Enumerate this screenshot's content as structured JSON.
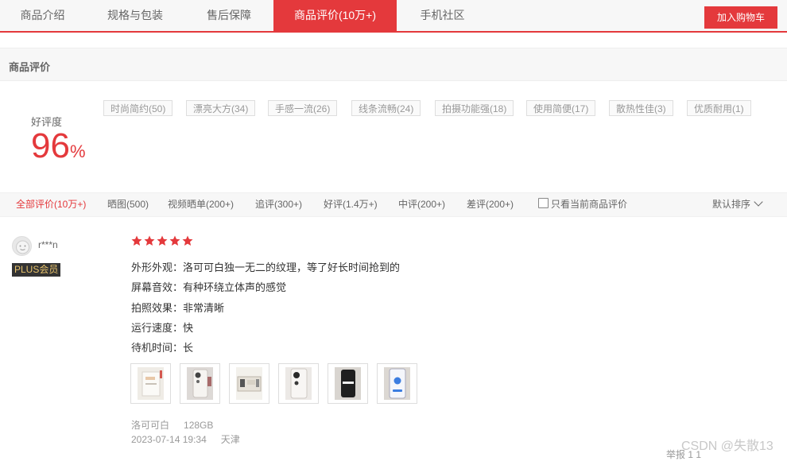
{
  "tabs": [
    {
      "label": "商品介绍",
      "active": false
    },
    {
      "label": "规格与包装",
      "active": false
    },
    {
      "label": "售后保障",
      "active": false
    },
    {
      "label": "商品评价(10万+)",
      "active": true
    },
    {
      "label": "手机社区",
      "active": false
    }
  ],
  "cart_button": "加入购物车",
  "section_title": "商品评价",
  "rating": {
    "label": "好评度",
    "value": "96",
    "unit": "%"
  },
  "tags": [
    "时尚简约(50)",
    "漂亮大方(34)",
    "手感一流(26)",
    "线条流畅(24)",
    "拍摄功能强(18)",
    "使用简便(17)",
    "散热性佳(3)",
    "优质耐用(1)"
  ],
  "filters": [
    {
      "label": "全部评价(10万+)",
      "active": true
    },
    {
      "label": "晒图(500)",
      "active": false
    },
    {
      "label": "视频晒单(200+)",
      "active": false
    },
    {
      "label": "追评(300+)",
      "active": false
    },
    {
      "label": "好评(1.4万+)",
      "active": false
    },
    {
      "label": "中评(200+)",
      "active": false
    },
    {
      "label": "差评(200+)",
      "active": false
    }
  ],
  "only_current_label": "只看当前商品评价",
  "only_current_checked": false,
  "sort_label": "默认排序",
  "review": {
    "username": "r***n",
    "badge": "PLUS会员",
    "stars": 5,
    "lines": [
      "外形外观：洛可可白独一无二的纹理，等了好长时间抢到的",
      "屏幕音效：有种环绕立体声的感觉",
      "拍照效果：非常清晰",
      "运行速度：快",
      "待机时间：长"
    ],
    "images": [
      "phone-photo",
      "phone-photo",
      "phone-photo",
      "phone-photo",
      "phone-photo",
      "phone-photo"
    ],
    "color": "洛可可白",
    "storage": "128GB",
    "date": "2023-07-14 19:34",
    "location": "天津"
  },
  "footer_fragment": "举报    1    1",
  "watermark": "CSDN @失散13",
  "colors": {
    "accent": "#e4393c",
    "plus_bg": "#333333",
    "plus_text": "#e8c36c"
  }
}
